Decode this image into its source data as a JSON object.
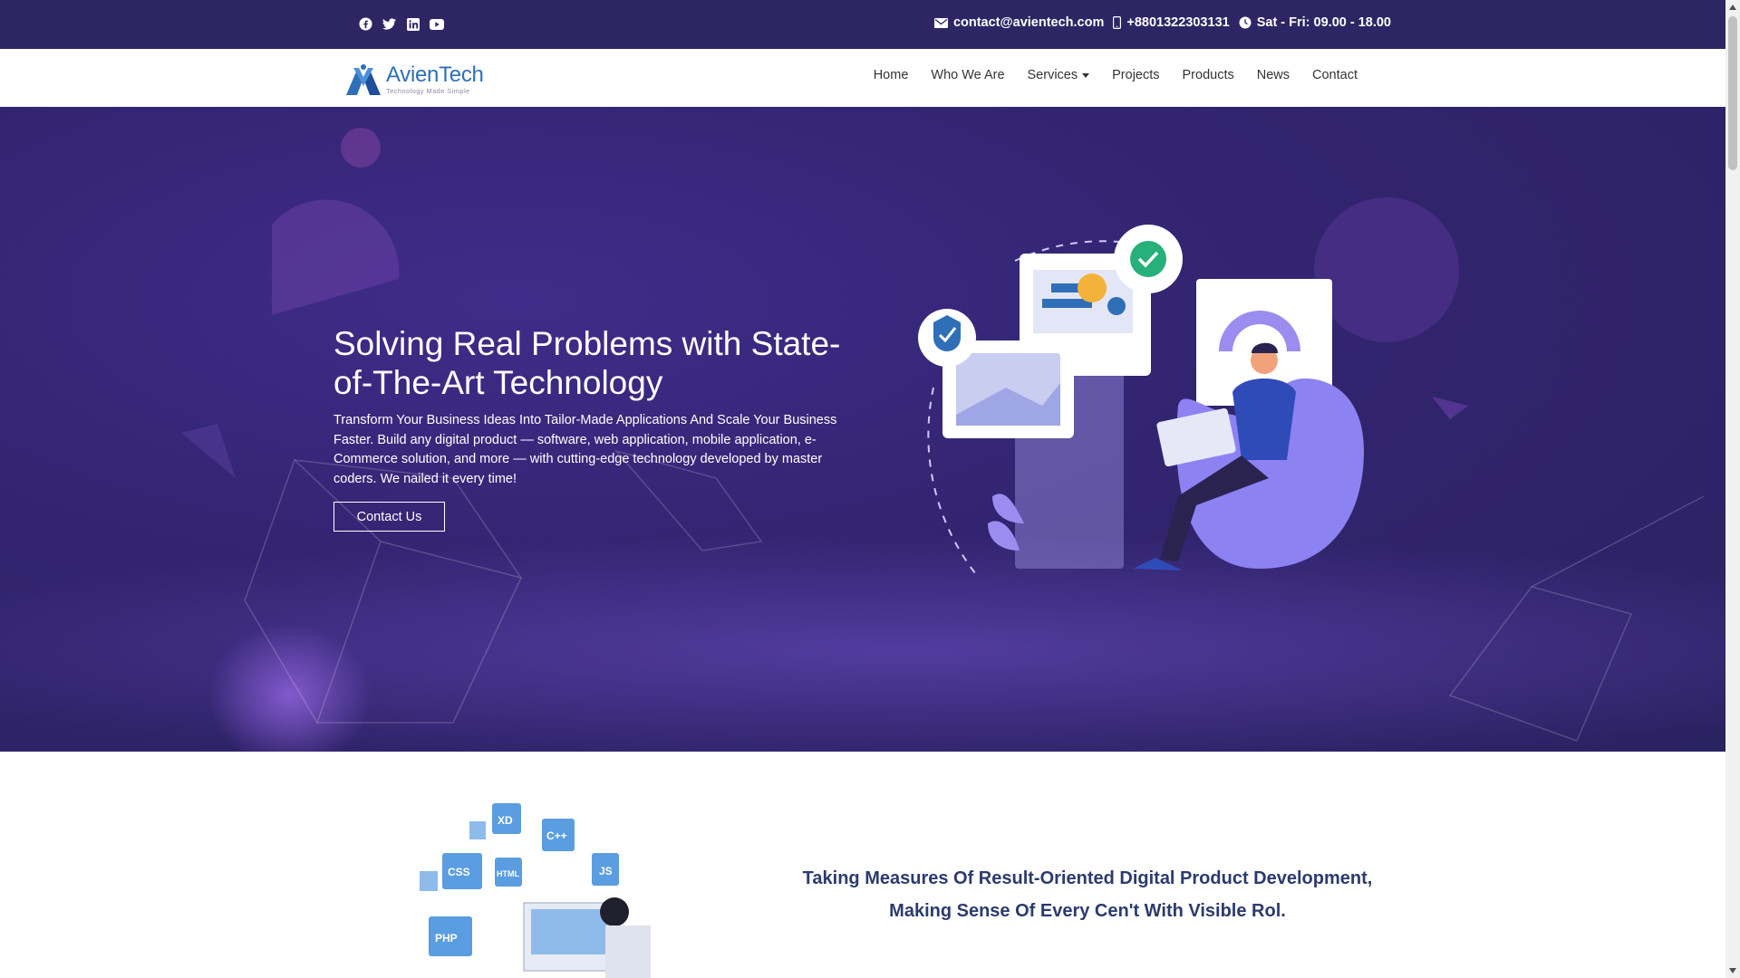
{
  "topbar": {
    "social": [
      "facebook-icon",
      "twitter-icon",
      "linkedin-icon",
      "youtube-icon"
    ],
    "email": "contact@avientech.com",
    "phone": "+8801322303131",
    "hours": "Sat - Fri: 09.00 - 18.00"
  },
  "brand": {
    "name": "AvienTech",
    "tagline": "Technology Made Simple"
  },
  "nav": {
    "items": [
      {
        "label": "Home"
      },
      {
        "label": "Who We Are"
      },
      {
        "label": "Services"
      },
      {
        "label": "Projects"
      },
      {
        "label": "Products"
      },
      {
        "label": "News"
      },
      {
        "label": "Contact"
      }
    ]
  },
  "hero": {
    "title": "Solving Real Problems with State-of-The-Art Technology",
    "subtitle": "Transform Your Business Ideas Into Tailor-Made Applications And Scale Your Business Faster. Build any digital product — software, web application, mobile application, e-Commerce solution, and more — with cutting-edge technology developed by master coders. We nailed it every time!",
    "cta": "Contact Us"
  },
  "section2": {
    "heading": "Taking Measures Of Result-Oriented Digital Product Development, Making Sense Of Every Cen't With Visible Rol.",
    "tiles": [
      "XD",
      "C++",
      "CSS",
      "HTML",
      "JS",
      "PHP"
    ]
  },
  "colors": {
    "topbar": "#2e2664",
    "hero": "#32246f",
    "accent": "#2f6fb8",
    "heading": "#2b3b6e"
  }
}
